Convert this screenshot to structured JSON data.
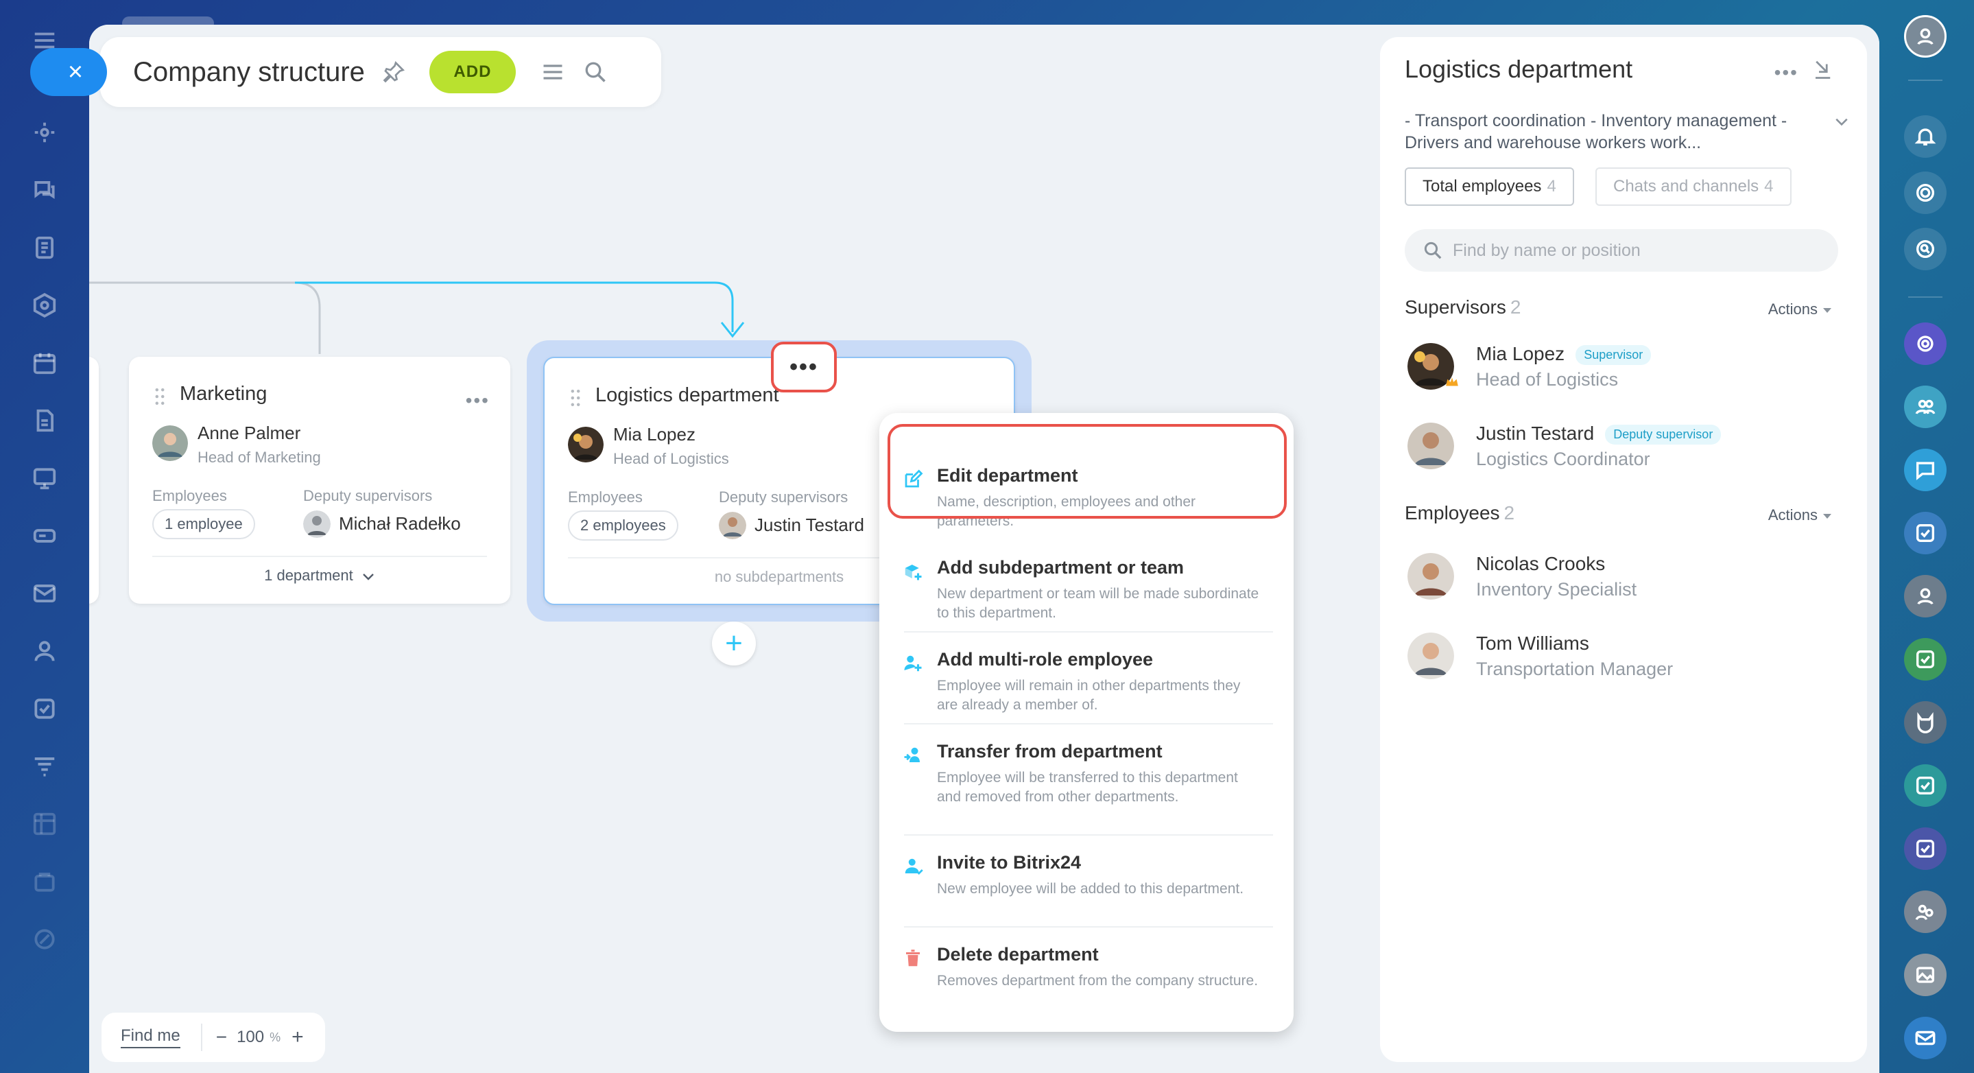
{
  "header": {
    "title": "Company structure",
    "add_label": "ADD"
  },
  "departments": {
    "marketing": {
      "name": "Marketing",
      "head_name": "Anne Palmer",
      "head_role": "Head of Marketing",
      "employees_label": "Employees",
      "employees_count": "1 employee",
      "deputy_label": "Deputy supervisors",
      "deputy_name": "Michał Radełko",
      "footer": "1 department"
    },
    "logistics": {
      "name": "Logistics department",
      "head_name": "Mia Lopez",
      "head_role": "Head of Logistics",
      "employees_label": "Employees",
      "employees_count": "2 employees",
      "deputy_label": "Deputy supervisors",
      "deputy_name": "Justin Testard",
      "footer": "no subdepartments"
    }
  },
  "menu": {
    "items": [
      {
        "title": "Edit department",
        "desc": "Name, description, employees and other parameters.",
        "icon": "edit-icon"
      },
      {
        "title": "Add subdepartment or team",
        "desc": "New department or team will be made subordinate to this department.",
        "icon": "add-subdepartment-icon"
      },
      {
        "title": "Add multi-role employee",
        "desc": "Employee will remain in other departments they are already a member of.",
        "icon": "add-user-icon"
      },
      {
        "title": "Transfer from department",
        "desc": "Employee will be transferred to this department and removed from other departments.",
        "icon": "transfer-icon"
      },
      {
        "title": "Invite to Bitrix24",
        "desc": "New employee will be added to this department.",
        "icon": "invite-icon"
      },
      {
        "title": "Delete department",
        "desc": "Removes department from the company structure.",
        "icon": "trash-icon"
      }
    ]
  },
  "zoom": {
    "find_me": "Find me",
    "minus": "−",
    "value": "100",
    "unit": "%",
    "plus": "+"
  },
  "panel": {
    "title": "Logistics department",
    "description": "- Transport coordination - Inventory management - Drivers and warehouse workers work...",
    "tabs": [
      {
        "label": "Total employees",
        "count": "4"
      },
      {
        "label": "Chats and channels",
        "count": "4"
      }
    ],
    "search_placeholder": "Find by name or position",
    "supervisors": {
      "label": "Supervisors",
      "count": "2",
      "actions": "Actions",
      "people": [
        {
          "name": "Mia Lopez",
          "badge": "Supervisor",
          "role": "Head of Logistics"
        },
        {
          "name": "Justin Testard",
          "badge": "Deputy supervisor",
          "role": "Logistics Coordinator"
        }
      ]
    },
    "employees": {
      "label": "Employees",
      "count": "2",
      "actions": "Actions",
      "people": [
        {
          "name": "Nicolas Crooks",
          "role": "Inventory Specialist"
        },
        {
          "name": "Tom Williams",
          "role": "Transportation Manager"
        }
      ]
    }
  },
  "colors": {
    "accent_blue": "#1e8cf0",
    "add_green": "#b9e12f",
    "highlight_red": "#e9524a",
    "connector": "#2fc6f6",
    "selected_glow": "#c9dbf7"
  }
}
